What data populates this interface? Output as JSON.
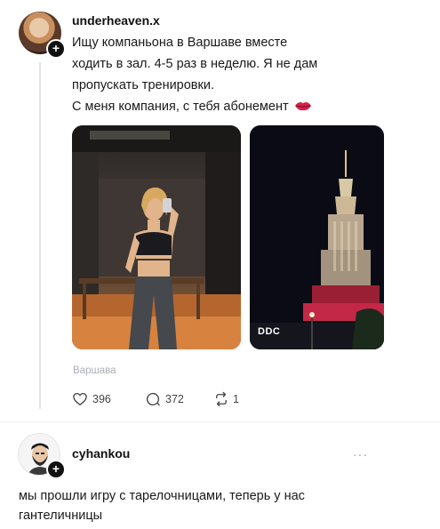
{
  "post": {
    "username": "underheaven.x",
    "text_lines": [
      "Ищу компаньона в Варшаве вместе",
      "ходить в зал. 4-5 раз в неделю. Я не дам",
      "пропускать тренировки.",
      "С меня компания, с тебя абонемент"
    ],
    "photo_watermark": "DDC",
    "location": "Варшава",
    "likes": "396",
    "comments": "372",
    "reposts": "1"
  },
  "reply": {
    "username": "cyhankou",
    "more_label": "···",
    "text_lines": [
      "мы прошли игру с тарелочницами, теперь у нас",
      "гантеличницы"
    ]
  },
  "icons": {
    "heart": "heart-icon",
    "comment": "comment-icon",
    "repost": "repost-icon",
    "lips": "lips-emoji",
    "follow": "plus-icon",
    "more": "more-icon"
  },
  "colors": {
    "background": "#ffffff",
    "text": "#1a1a1a",
    "muted": "#aab0b8",
    "lips": "#d6204b"
  }
}
